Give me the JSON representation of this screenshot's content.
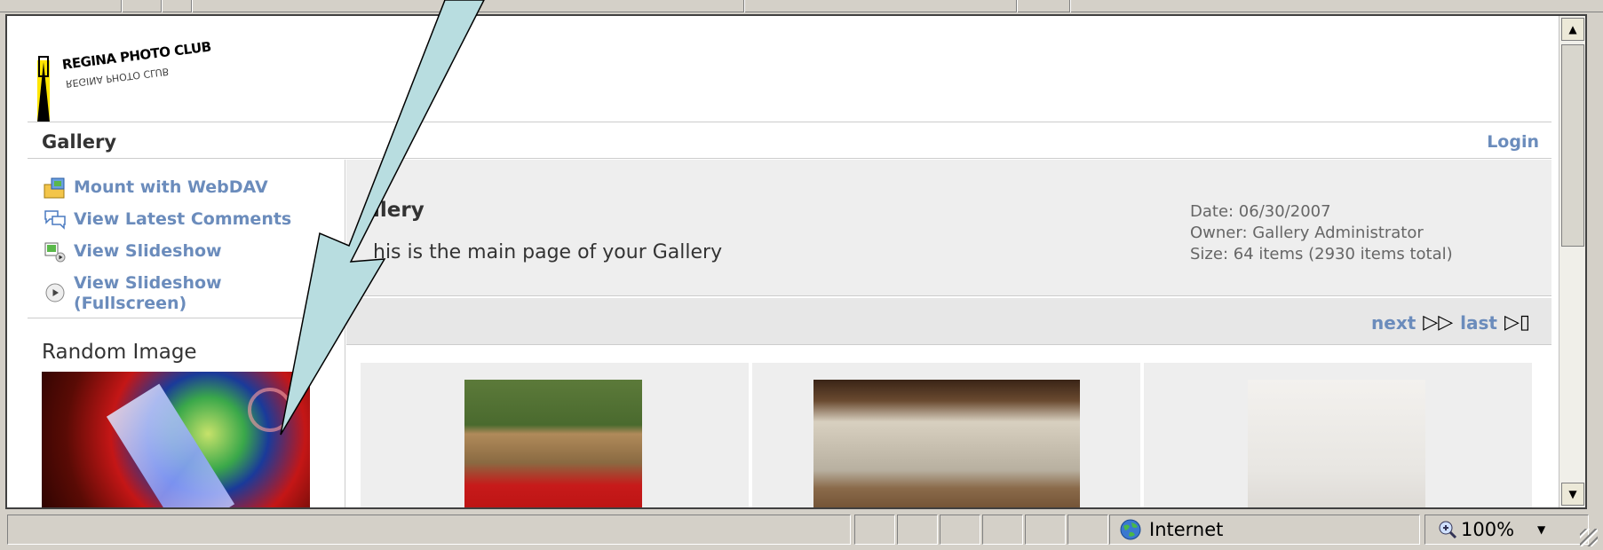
{
  "header": {
    "logo_line1": "REGINA PHOTO CLUB",
    "logo_line2": "REGINA PHOTO CLUB",
    "section_title": "Gallery",
    "login_label": "Login"
  },
  "sidebar": {
    "items": [
      {
        "label": "Mount with WebDAV",
        "icon": "webdav-folder-icon"
      },
      {
        "label": "View Latest Comments",
        "icon": "comments-icon"
      },
      {
        "label": "View Slideshow",
        "icon": "slideshow-icon"
      },
      {
        "label": "View Slideshow (Fullscreen)",
        "label_line1": "View Slideshow",
        "label_line2": "(Fullscreen)",
        "icon": "fullscreen-play-icon"
      }
    ],
    "random_heading": "Random Image"
  },
  "album": {
    "title": "llery",
    "description": "his is the main page of your Gallery",
    "date": "Date: 06/30/2007",
    "owner": "Owner: Gallery Administrator",
    "size": "Size: 64 items (2930 items total)"
  },
  "pager": {
    "next_label": "next",
    "next_glyph": "▷▷",
    "last_label": "last",
    "last_glyph": "▷▯"
  },
  "statusbar": {
    "zone_label": "Internet",
    "zoom_label": "100%"
  },
  "colors": {
    "link": "#6b8cbc",
    "panel": "#eeeeee",
    "arrow_fill": "#b8dde0"
  }
}
